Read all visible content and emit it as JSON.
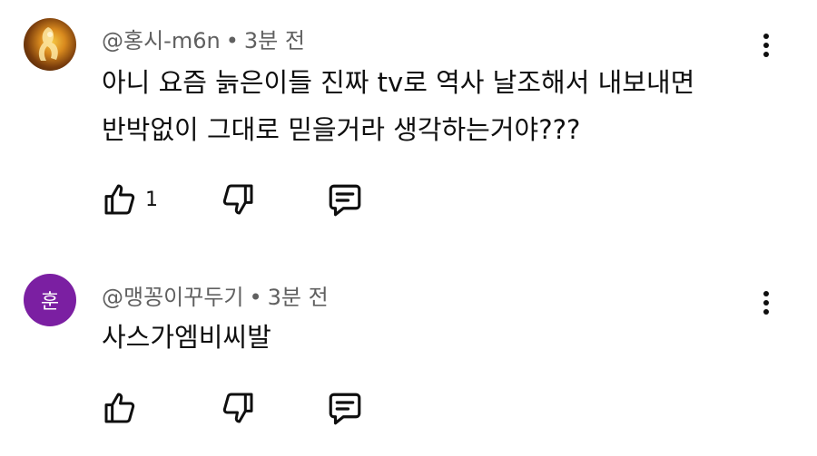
{
  "comments": [
    {
      "author": "@홍시-m6n",
      "separator": "•",
      "time": "3분 전",
      "avatar_letter": "",
      "text_lines": [
        "아니 요즘 늙은이들 진짜 tv로 역사 날조해서 내보내면",
        "반박없이 그대로 믿을거라 생각하는거야???"
      ],
      "like_count": "1",
      "icons": {
        "like": "thumb-up-icon",
        "dislike": "thumb-down-icon",
        "reply": "reply-icon",
        "more": "more-vert-icon"
      }
    },
    {
      "author": "@맹꽁이꾸두기",
      "separator": "•",
      "time": "3분 전",
      "avatar_letter": "훈",
      "avatar_color": "#7b1fa2",
      "text_lines": [
        "사스가엠비씨발"
      ],
      "like_count": "",
      "icons": {
        "like": "thumb-up-icon",
        "dislike": "thumb-down-icon",
        "reply": "reply-icon",
        "more": "more-vert-icon"
      }
    }
  ]
}
